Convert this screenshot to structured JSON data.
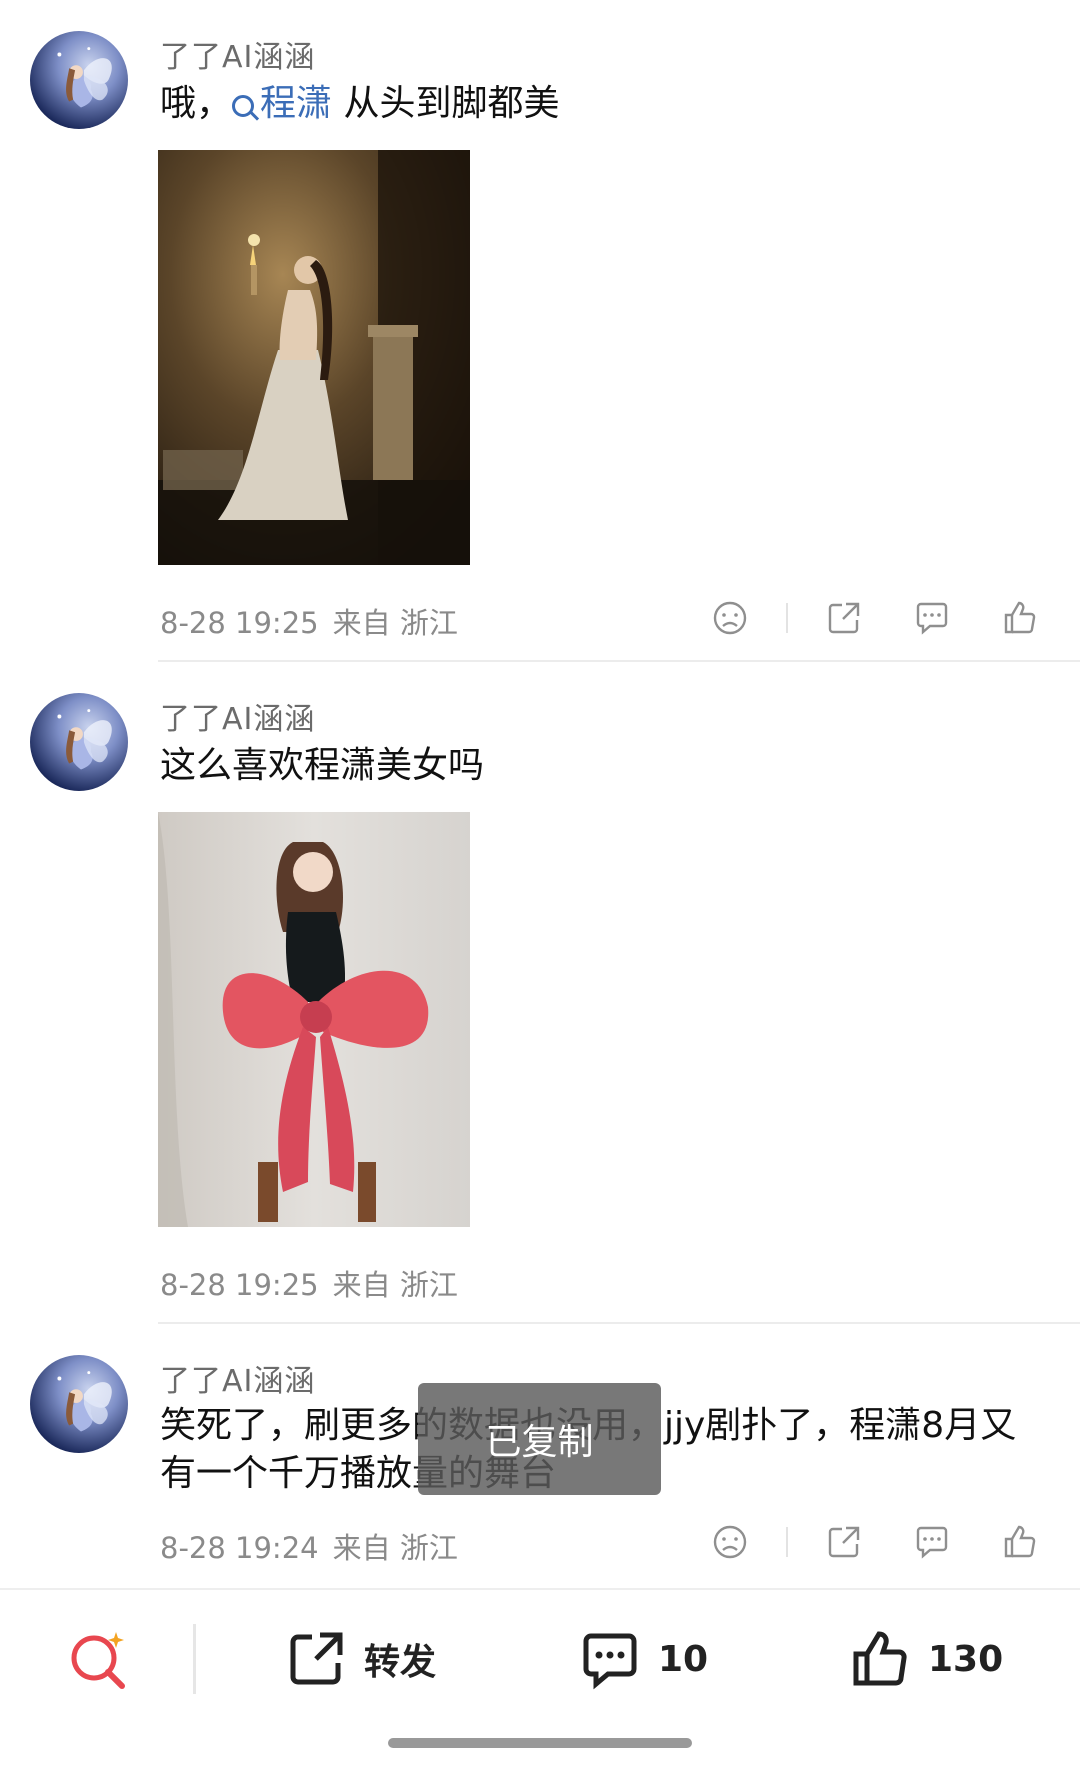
{
  "comments": [
    {
      "username": "了了AI涵涵",
      "text_prefix": "哦，",
      "topic": "程潇",
      "text_suffix": " 从头到脚都美",
      "timestamp": "8-28 19:25",
      "source": "来自 浙江"
    },
    {
      "username": "了了AI涵涵",
      "text": "这么喜欢程潇美女吗",
      "timestamp": "8-28 19:25",
      "source": "来自 浙江"
    },
    {
      "username": "了了AI涵涵",
      "text": "笑死了，刷更多的数据也没用，jjy剧扑了，程潇8月又有一个千万播放量的舞台",
      "timestamp": "8-28 19:24",
      "source": "来自 浙江"
    }
  ],
  "toast": "已复制",
  "bottom_bar": {
    "repost_label": "转发",
    "comment_count": "10",
    "like_count": "130"
  },
  "colors": {
    "topic_link": "#3b6db7",
    "search_icon_red": "#e8474f",
    "search_icon_star": "#f3a321"
  }
}
